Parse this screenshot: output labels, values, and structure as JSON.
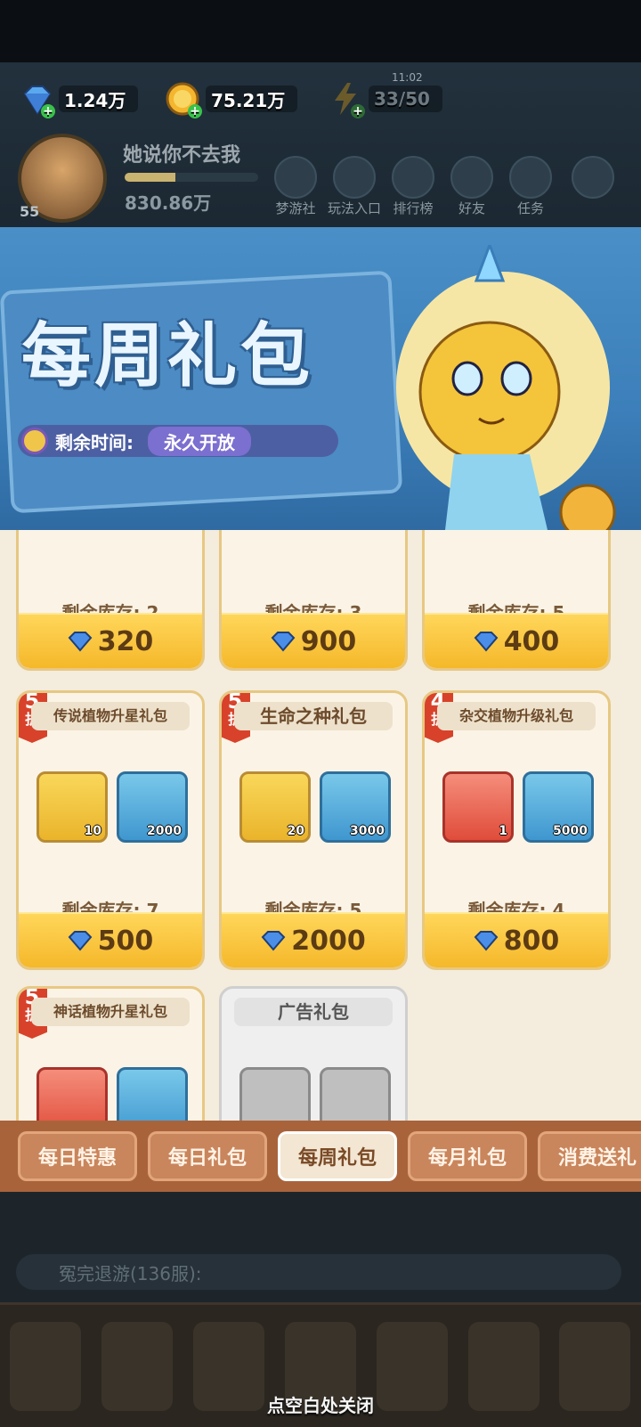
{
  "resources": {
    "gems": "1.24万",
    "coins": "75.21万",
    "energy": "33/50",
    "energy_timer": "11:02"
  },
  "player": {
    "name": "她说你不去我",
    "level": "55",
    "power": "830.86万"
  },
  "top_menu": [
    {
      "label": "梦游社",
      "icon": "club-icon"
    },
    {
      "label": "玩法入口",
      "icon": "gamepad-icon"
    },
    {
      "label": "排行榜",
      "icon": "ranking-icon"
    },
    {
      "label": "好友",
      "icon": "friends-icon"
    },
    {
      "label": "任务",
      "icon": "task-icon"
    }
  ],
  "banner": {
    "title": "每周礼包",
    "timer_label": "剩余时间:",
    "timer_value": "永久开放"
  },
  "row1": [
    {
      "stock": "剩余库存: 2",
      "price": "320"
    },
    {
      "stock": "剩余库存: 3",
      "price": "900"
    },
    {
      "stock": "剩余库存: 5",
      "price": "400"
    }
  ],
  "row2": [
    {
      "discount": "5",
      "discount_unit": "折",
      "title": "传说植物升星礼包",
      "items": [
        {
          "icon": "potion-icon",
          "qty": "10"
        },
        {
          "icon": "coin-icon",
          "qty": "2000"
        }
      ],
      "stock": "剩余库存: 7",
      "price": "500"
    },
    {
      "discount": "5",
      "discount_unit": "折",
      "title": "生命之种礼包",
      "items": [
        {
          "icon": "seed-icon",
          "qty": "20"
        },
        {
          "icon": "coin-icon",
          "qty": "3000"
        }
      ],
      "stock": "剩余库存: 5",
      "price": "2000"
    },
    {
      "discount": "4",
      "discount_unit": "折",
      "title": "杂交植物升级礼包",
      "items": [
        {
          "icon": "tube-icon",
          "qty": "1"
        },
        {
          "icon": "coin-icon",
          "qty": "5000"
        }
      ],
      "stock": "剩余库存: 4",
      "price": "800"
    }
  ],
  "row3": [
    {
      "discount": "5",
      "discount_unit": "折",
      "title": "神话植物升星礼包"
    },
    {
      "title": "广告礼包"
    }
  ],
  "tabs": [
    "每日特惠",
    "每日礼包",
    "每周礼包",
    "每月礼包",
    "消费送礼"
  ],
  "active_tab": "每周礼包",
  "chat_text": "冤完退游(136服):",
  "close_hint": "点空白处关闭",
  "colors": {
    "price_bar": "#f5b82a",
    "discount_tag": "#d8422a",
    "tab_bar": "#a9633b",
    "banner": "#3c7fba"
  }
}
